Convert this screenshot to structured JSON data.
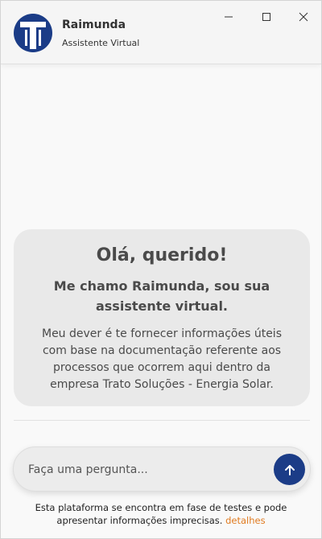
{
  "header": {
    "title": "Raimunda",
    "subtitle": "Assistente Virtual",
    "logo_icon": "trato-logo-icon",
    "accent_color": "#1b3c87"
  },
  "window_controls": {
    "minimize_icon": "minimize-icon",
    "maximize_icon": "maximize-icon",
    "close_icon": "close-icon"
  },
  "welcome": {
    "title": "Olá, querido!",
    "subtitle": "Me chamo Raimunda, sou sua assistente virtual.",
    "body": "Meu dever é te fornecer informações úteis com base na documentação referente aos processos que ocorrem aqui dentro da empresa Trato Soluções - Energia Solar."
  },
  "composer": {
    "placeholder": "Faça uma pergunta...",
    "value": "",
    "send_icon": "arrow-up-icon"
  },
  "footer": {
    "disclaimer": "Esta plataforma se encontra em fase de testes e pode apresentar informações imprecisas.",
    "link_label": "detalhes",
    "link_color": "#e07a1f"
  }
}
